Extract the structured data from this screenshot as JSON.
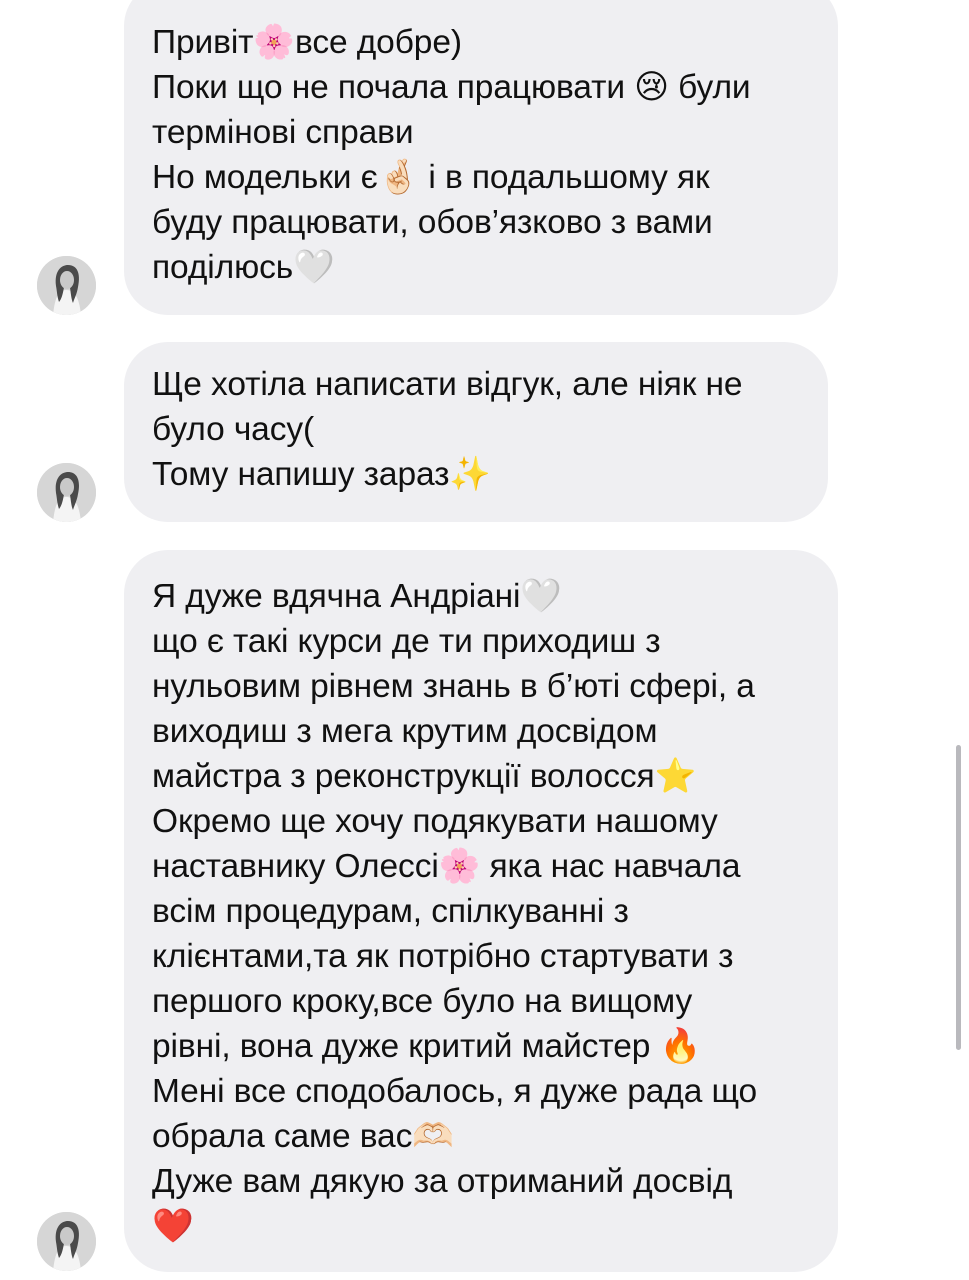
{
  "messages": [
    {
      "lines": [
        "Привіт🌸все добре)",
        "Поки що не почала працювати 😢 були",
        "термінові справи",
        "Но модельки є🤞🏻 і в подальшому як",
        "буду працювати, обов’язково з вами",
        "поділюсь🤍"
      ]
    },
    {
      "lines": [
        "Ще хотіла написати відгук, але ніяк не",
        "було часу(",
        "Тому напишу зараз✨"
      ]
    },
    {
      "lines": [
        "Я дуже вдячна Андріані🤍",
        "що є такі курси де ти приходиш з",
        "нульовим рівнем знань в б’юті сфері, а",
        "виходиш з мега крутим досвідом",
        "майстра з реконструкції волосся⭐️",
        "Окремо ще хочу подякувати нашому",
        "наставнику Олессі🌸 яка нас навчала",
        "всім процедурам, спілкуванні з",
        "клієнтами,та як потрібно стартувати з",
        "першого кроку,все було на вищому",
        "рівні, вона дуже критий майстер 🔥",
        "Мені все сподобалось, я дуже рада що",
        "обрала саме вас🫶🏻",
        "Дуже вам дякую за отриманий досвід",
        "❤️"
      ]
    }
  ],
  "colors": {
    "bubble": "#efeff2",
    "text": "#111111",
    "background": "#ffffff"
  },
  "icons": {
    "avatar": "profile-photo-avatar"
  }
}
